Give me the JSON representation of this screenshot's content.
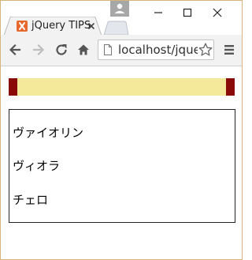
{
  "browser": {
    "tab": {
      "title": "jQuery TIPS",
      "favicon": "xampp-favicon-icon"
    },
    "address_bar": {
      "url": "localhost/jquery"
    },
    "toolbar_icons": [
      "back-icon",
      "forward-icon",
      "reload-icon",
      "home-icon",
      "star-icon",
      "menu-icon"
    ],
    "window_controls": [
      "minimize-icon",
      "maximize-icon",
      "close-icon"
    ]
  },
  "page": {
    "bar": {
      "fill_color": "#f4e89a",
      "handle_color": "#8a0a0a"
    },
    "list": {
      "items": [
        "ヴァイオリン",
        "ヴィオラ",
        "チェロ"
      ]
    }
  },
  "colors": {
    "favicon": "#e8672c",
    "toolbar": "#f2f2f2",
    "window_border": "#d9b47a"
  }
}
